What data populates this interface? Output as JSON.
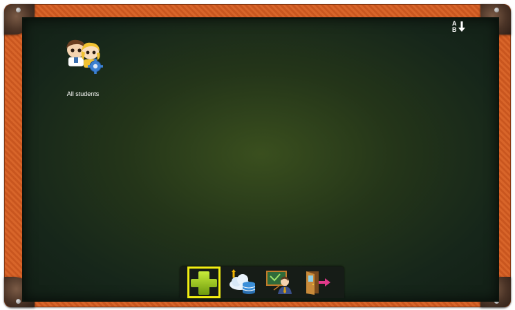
{
  "board": {
    "sort_button": {
      "top_letter": "A",
      "bottom_letter": "B",
      "icon": "sort-az-icon"
    },
    "groups": [
      {
        "label": "All students",
        "icon": "students-gear-icon"
      }
    ]
  },
  "toolbar": {
    "items": [
      {
        "icon": "add-plus-icon",
        "selected": true
      },
      {
        "icon": "cloud-database-upload-icon",
        "selected": false
      },
      {
        "icon": "teacher-blackboard-icon",
        "selected": false
      },
      {
        "icon": "exit-door-icon",
        "selected": false
      }
    ]
  },
  "colors": {
    "frame": "#d8652a",
    "board": "#243519",
    "selection": "#f2ee12",
    "add_green": "#9ccc1a"
  }
}
